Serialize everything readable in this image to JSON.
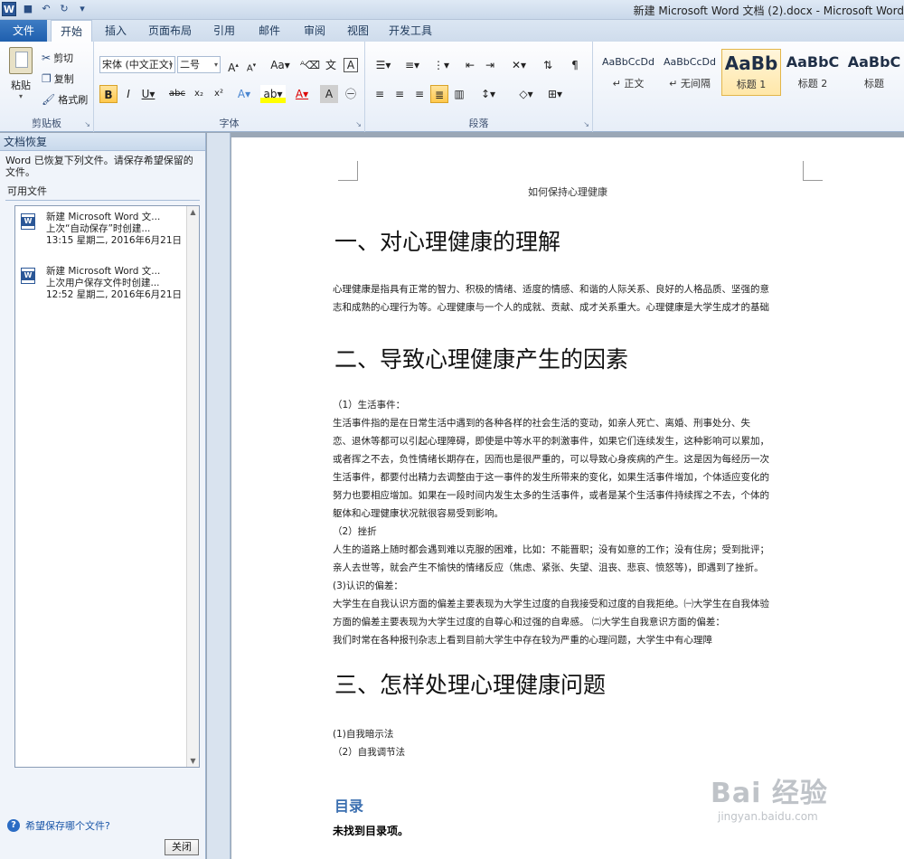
{
  "window": {
    "title": "新建 Microsoft Word 文档 (2).docx - Microsoft Word"
  },
  "quick_access": {
    "undo": "↶",
    "redo": "↻"
  },
  "tabs": [
    {
      "label": "文件"
    },
    {
      "label": "开始"
    },
    {
      "label": "插入"
    },
    {
      "label": "页面布局"
    },
    {
      "label": "引用"
    },
    {
      "label": "邮件"
    },
    {
      "label": "审阅"
    },
    {
      "label": "视图"
    },
    {
      "label": "开发工具"
    }
  ],
  "clipboard": {
    "group": "剪贴板",
    "paste": "粘贴",
    "cut": "剪切",
    "copy": "复制",
    "format_painter": "格式刷"
  },
  "font": {
    "group": "字体",
    "family": "宋体 (中文正文)",
    "size": "二号"
  },
  "paragraph": {
    "group": "段落"
  },
  "styles": [
    {
      "preview": "AaBbCcDd",
      "name": "↵ 正文"
    },
    {
      "preview": "AaBbCcDd",
      "name": "↵ 无间隔"
    },
    {
      "preview": "AaBb",
      "name": "标题 1"
    },
    {
      "preview": "AaBbC",
      "name": "标题 2"
    },
    {
      "preview": "AaBbC",
      "name": "标题"
    }
  ],
  "recovery": {
    "title": "文档恢复",
    "message": "Word 已恢复下列文件。请保存希望保留的文件。",
    "available": "可用文件",
    "files": [
      {
        "name": "新建 Microsoft Word 文...",
        "status": "上次“自动保存”时创建...",
        "time": "13:15 星期二, 2016年6月21日"
      },
      {
        "name": "新建 Microsoft Word 文...",
        "status": "上次用户保存文件时创建...",
        "time": "12:52 星期二, 2016年6月21日"
      }
    ],
    "help": "希望保存哪个文件?",
    "close": "关闭"
  },
  "document": {
    "header": "如何保持心理健康",
    "h1": "一、对心理健康的理解",
    "p1": [
      "心理健康是指具有正常的智力、积极的情绪、适度的情感、和谐的人际关系、良好的人格品质、坚强的意",
      "志和成熟的心理行为等。心理健康与一个人的成就、贡献、成才关系重大。心理健康是大学生成才的基础"
    ],
    "h2": "二、导致心理健康产生的因素",
    "p2": [
      "（1）生活事件：",
      "      生活事件指的是在日常生活中遇到的各种各样的社会生活的变动，如亲人死亡、离婚、刑事处分、失",
      "恋、退休等都可以引起心理障碍，即使是中等水平的刺激事件，如果它们连续发生，这种影响可以累加，",
      "或者挥之不去，负性情绪长期存在，因而也是很严重的，可以导致心身疾病的产生。这是因为每经历一次",
      "生活事件，都要付出精力去调整由于这一事件的发生所带来的变化，如果生活事件增加，个体适应变化的",
      "努力也要相应增加。如果在一段时间内发生太多的生活事件，或者是某个生活事件持续挥之不去，个体的",
      "躯体和心理健康状况就很容易受到影响。",
      "（2）挫折",
      " 人生的道路上随时都会遇到难以克服的困难，比如：不能晋职；没有如意的工作；没有住房；受到批评；",
      "亲人去世等，就会产生不愉快的情绪反应（焦虑、紧张、失望、沮丧、悲哀、愤怒等)，即遇到了挫折。",
      "(3)认识的偏差：",
      "大学生在自我认识方面的偏差主要表现为大学生过度的自我接受和过度的自我拒绝。㈠大学生在自我体验",
      "方面的偏差主要表现为大学生过度的自尊心和过强的自卑感。 ㈡大学生自我意识方面的偏差：",
      "我们时常在各种报刊杂志上看到目前大学生中存在较为严重的心理问题，大学生中有心理障"
    ],
    "h3": "三、怎样处理心理健康问题",
    "p3": [
      "(1)自我暗示法",
      "（2）自我调节法"
    ],
    "toc_title": "目录",
    "toc_empty": "未找到目录项。"
  },
  "watermark": {
    "big": "Bai 经验",
    "small": "jingyan.baidu.com"
  }
}
